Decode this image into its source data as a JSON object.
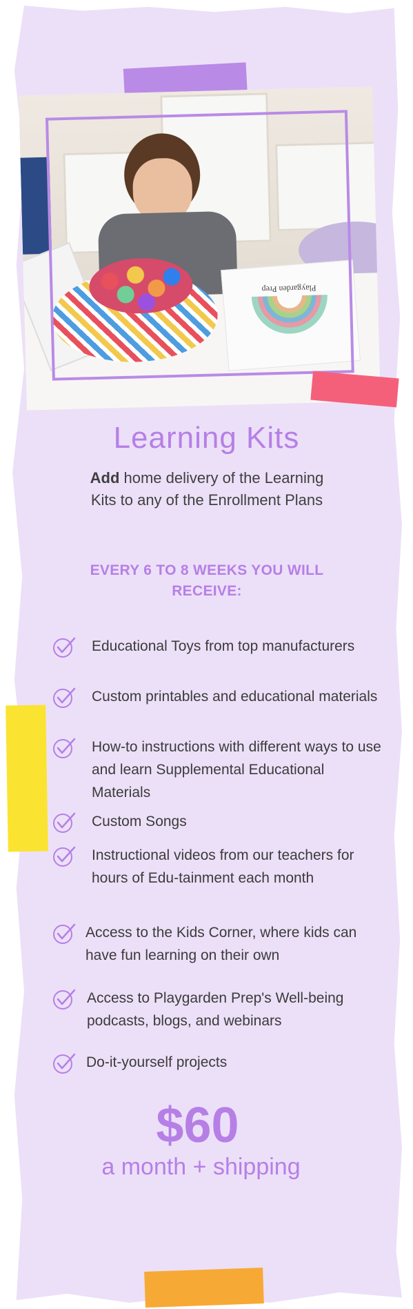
{
  "photo": {
    "card_brand": "Playgarden Prep"
  },
  "heading": {
    "title": "Learning Kits",
    "subtitle_bold": "Add",
    "subtitle_rest": " home delivery of the Learning Kits to any of the Enrollment Plans",
    "every_label": "EVERY 6 TO 8 WEEKS YOU WILL RECEIVE:"
  },
  "checklist": {
    "icon": "check-circle-icon",
    "accent_color": "#b67fe6",
    "items": [
      {
        "text": " Educational Toys from top manufacturers"
      },
      {
        "text": "Custom printables and educational materials"
      },
      {
        "text": "How-to instructions with different ways to use and learn Supplemental Educational Materials"
      },
      {
        "text": "Custom Songs"
      },
      {
        "text": "Instructional videos from our teachers for hours of Edu-tainment each month"
      },
      {
        "text": "Access to the Kids Corner, where kids can have fun learning on their own"
      },
      {
        "text": "Access to Playgarden Prep's Well-being podcasts, blogs, and webinars"
      },
      {
        "text": "Do-it-yourself projects"
      }
    ]
  },
  "pricing": {
    "amount": "$60",
    "period": "a month + shipping"
  },
  "colors": {
    "paper": "#ece0f8",
    "accent": "#b67fe6",
    "tape_purple": "#b98ae6",
    "tape_pink": "#f4607a",
    "tape_yellow": "#fbe331",
    "tape_orange": "#f7a935"
  }
}
